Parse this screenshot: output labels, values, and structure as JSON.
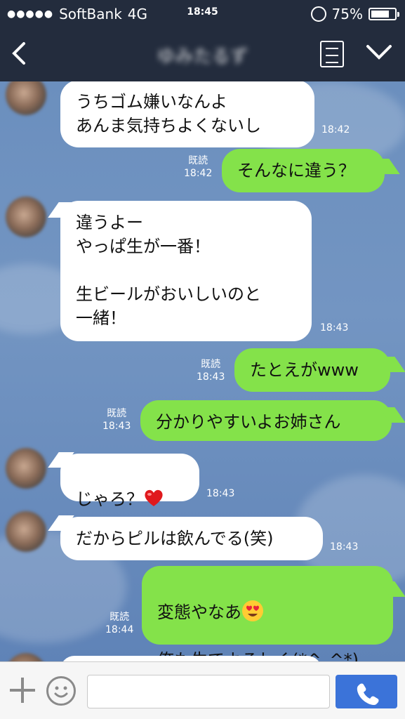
{
  "status": {
    "signal": "●●●●●",
    "carrier": "SoftBank",
    "network": "4G",
    "time": "18:45",
    "battery": "75%"
  },
  "header": {
    "title": "ゆみたるず"
  },
  "messages": [
    {
      "dir": "in",
      "text": "うちゴム嫌いなんよ\nあんま気持ちよくないし",
      "time": "18:42"
    },
    {
      "dir": "out",
      "read": "既読",
      "text": "そんなに違う？",
      "time": "18:42"
    },
    {
      "dir": "in",
      "text": "違うよー\nやっぱ生が一番！\n\n生ビールがおいしいのと\n一緒！",
      "time": "18:43"
    },
    {
      "dir": "out",
      "read": "既読",
      "text": "たとえがwww",
      "time": "18:43"
    },
    {
      "dir": "out",
      "read": "既読",
      "text": "分かりやすいよお姉さん",
      "time": "18:43"
    },
    {
      "dir": "in",
      "text": "じゃろ？",
      "time": "18:43"
    },
    {
      "dir": "in",
      "text": "だからピルは飲んでる(笑)",
      "time": "18:43"
    },
    {
      "dir": "out",
      "read": "既読",
      "text_line1": "変態やなあ",
      "text_line2": "俺も生でよろしく(*^_^*)",
      "time": "18:44"
    }
  ],
  "colors": {
    "header_bg": "#232c3d",
    "bubble_out": "#84e24a",
    "bubble_in": "#ffffff",
    "send_button": "#3b73d9"
  },
  "icons": {
    "back": "chevron-left-icon",
    "notes": "notes-icon",
    "menu": "chevron-down-icon",
    "plus": "plus-icon",
    "sticker": "smiley-icon",
    "call": "phone-icon",
    "heart": "heart-emoji",
    "heart_eyes": "heart-eyes-emoji"
  }
}
